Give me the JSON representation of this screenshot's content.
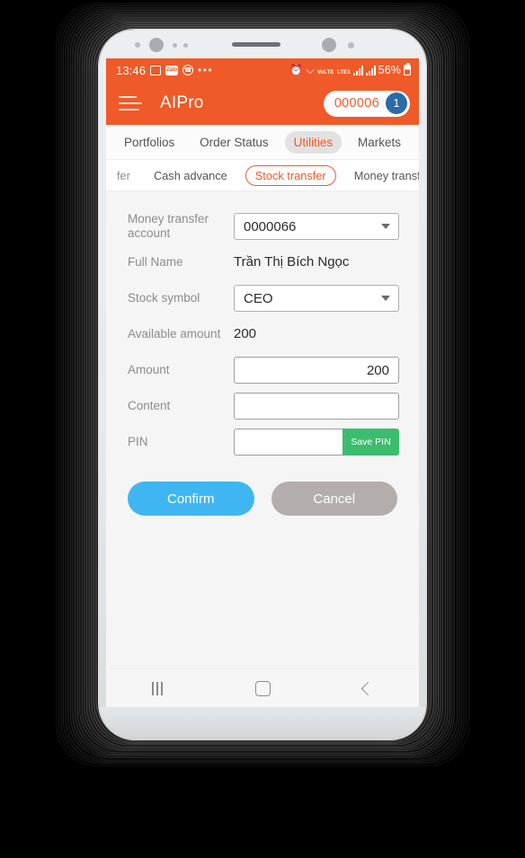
{
  "statusbar": {
    "time": "13:46",
    "left_icons": [
      "photo-icon",
      "zalo-icon",
      "call-icon",
      "more-icon"
    ],
    "zalo_label": "Zalo",
    "more": "•••",
    "alarm_icon": "alarm-icon",
    "wifi_icon": "wifi-icon",
    "volte_line1": "VoLTE",
    "volte_line2": "LTE1",
    "battery_percent": "56%"
  },
  "appbar": {
    "menu_icon": "hamburger-menu-icon",
    "title": "AIPro",
    "account_number": "000006",
    "account_badge": "1"
  },
  "primary_tabs": [
    {
      "label": "Portfolios",
      "active": false
    },
    {
      "label": "Order Status",
      "active": false
    },
    {
      "label": "Utilities",
      "active": true
    },
    {
      "label": "Markets",
      "active": false
    }
  ],
  "secondary_tabs": [
    {
      "label": "fer",
      "active": false,
      "clipped": true
    },
    {
      "label": "Cash advance",
      "active": false
    },
    {
      "label": "Stock transfer",
      "active": true
    },
    {
      "label": "Money transfer status",
      "active": false
    }
  ],
  "form": {
    "money_transfer_account": {
      "label": "Money transfer account",
      "value": "0000066",
      "caret": "chevron-down-icon"
    },
    "full_name": {
      "label": "Full Name",
      "value": "Trần Thị Bích Ngọc"
    },
    "stock_symbol": {
      "label": "Stock symbol",
      "value": "CEO",
      "caret": "chevron-down-icon"
    },
    "available_amount": {
      "label": "Available amount",
      "value": "200"
    },
    "amount": {
      "label": "Amount",
      "value": "200",
      "placeholder": ""
    },
    "content": {
      "label": "Content",
      "value": "",
      "placeholder": ""
    },
    "pin": {
      "label": "PIN",
      "value": "",
      "placeholder": "",
      "save_button": "Save PIN"
    }
  },
  "actions": {
    "confirm": "Confirm",
    "cancel": "Cancel"
  },
  "navbar": {
    "recent": "recent-apps-icon",
    "home": "home-icon",
    "back": "back-icon"
  },
  "colors": {
    "brand_orange": "#ef5a28",
    "confirm_blue": "#3fb6f2",
    "cancel_grey": "#b3aeac",
    "save_green": "#3cbc6f",
    "badge_blue": "#2a6ba8",
    "screen_bg": "#f5f5f5"
  }
}
